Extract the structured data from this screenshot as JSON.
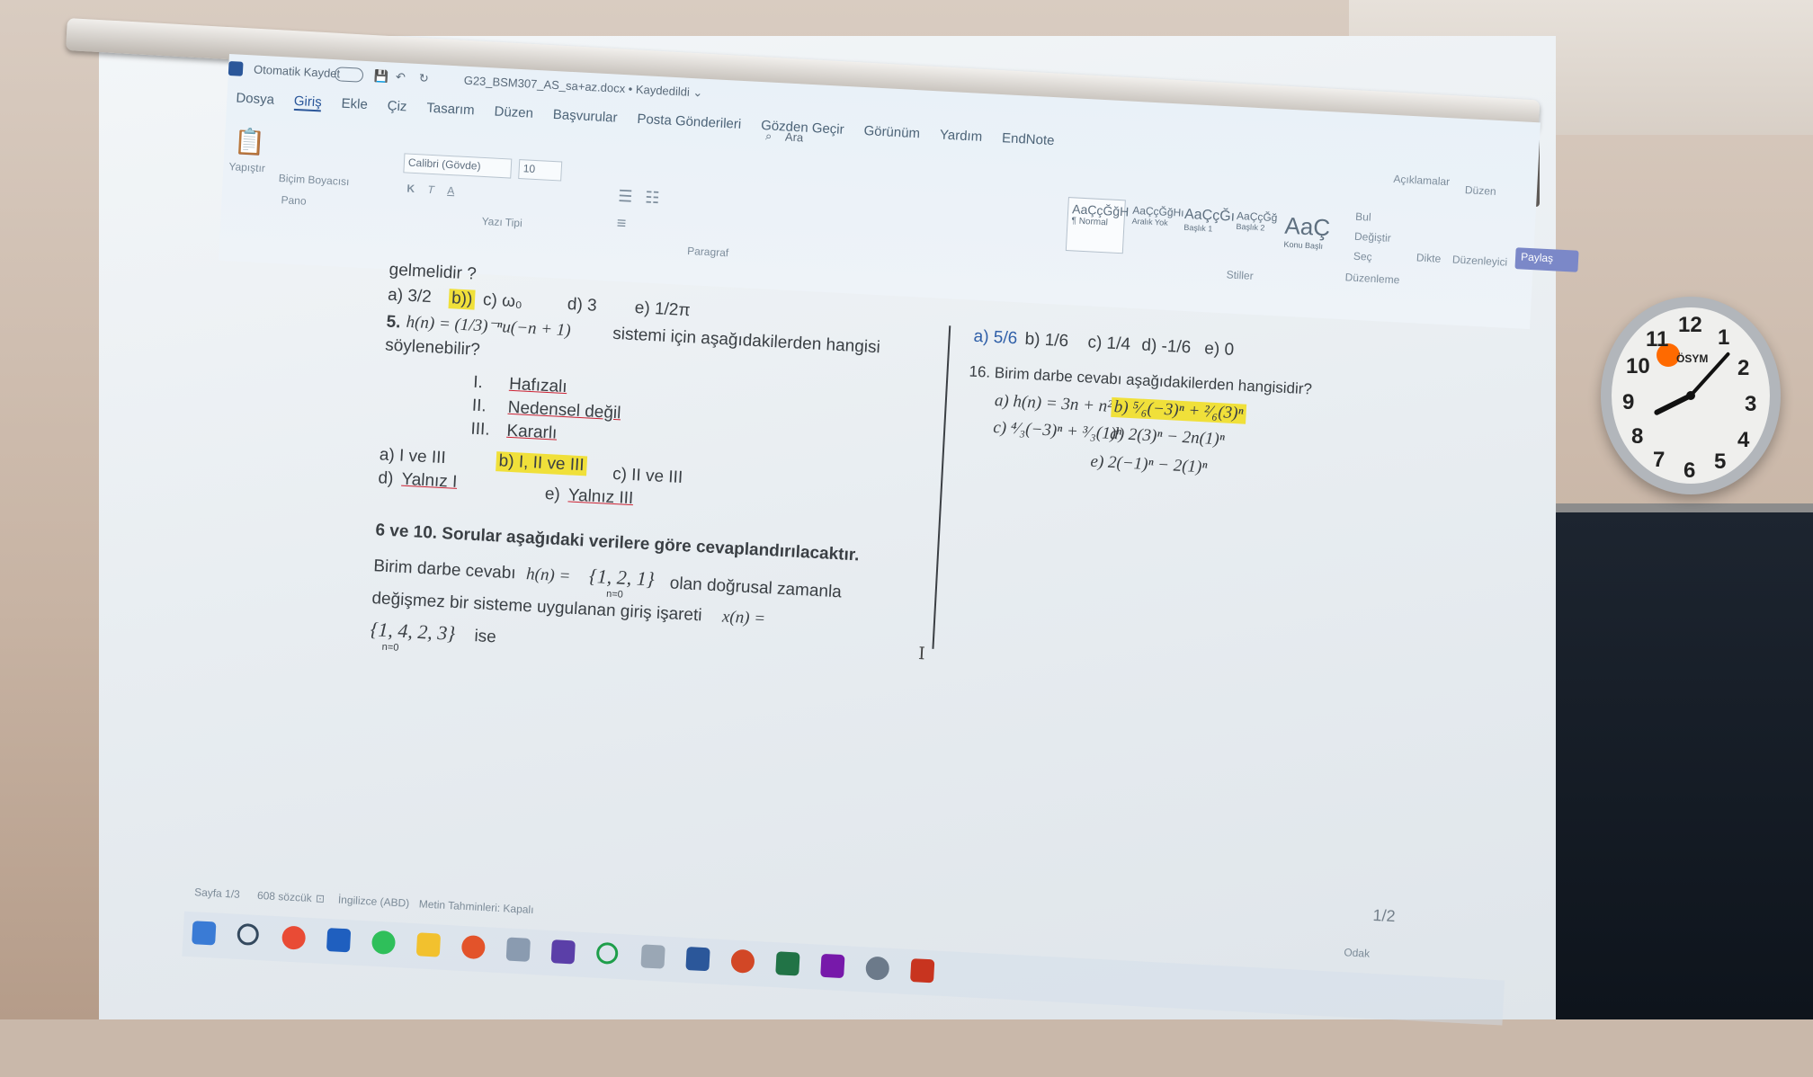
{
  "word": {
    "autosave_label": "Otomatik Kaydet",
    "file_title": "G23_BSM307_AS_sa+az.docx • Kaydedildi ⌄",
    "search_placeholder": "Ara",
    "menu": [
      "Dosya",
      "Giriş",
      "Ekle",
      "Çiz",
      "Tasarım",
      "Düzen",
      "Başvurular",
      "Posta Gönderileri",
      "Gözden Geçir",
      "Görünüm",
      "Yardım",
      "EndNote"
    ],
    "ribbon": {
      "paste": "Yapıştır",
      "format_painter": "Biçim Boyacısı",
      "clipboard_group": "Pano",
      "font_name": "Calibri (Gövde)",
      "font_size": "10",
      "font_group": "Yazı Tipi",
      "paragraph_group": "Paragraf",
      "style_normal": "AaÇçĞğH",
      "style_normal_label": "¶ Normal",
      "style_nospace": "AaÇçĞğHı",
      "style_nospace_label": "Aralık Yok",
      "style_h1": "AaÇçĞı",
      "style_h1_label": "Başlık 1",
      "style_h2": "AaÇçĞğ",
      "style_h2_label": "Başlık 2",
      "style_title": "AaÇ",
      "style_title_label": "Konu Başlı",
      "styles_group": "Stiller",
      "find": "Bul",
      "replace": "Değiştir",
      "select": "Seç",
      "editing_group": "Düzenleme",
      "dictate": "Dikte",
      "editor": "Düzenleyici",
      "comments": "Açıklamalar",
      "edit_mode": "Düzen",
      "share": "Paylaş"
    },
    "status": {
      "page": "Sayfa 1/3",
      "words": "608 sözcük",
      "language": "İngilizce (ABD)",
      "predictions": "Metin Tahminleri: Kapalı",
      "focus": "Odak",
      "page_indicator": "1/2"
    }
  },
  "document": {
    "left": {
      "q4_tail": "gelmelidir ?",
      "q4_opts": {
        "a": "a) 3/2",
        "b": "b))",
        "c": "c) ω₀",
        "d": "d) 3",
        "e": "e) 1/2π"
      },
      "q5_prefix": "5.",
      "q5_formula": "h(n) = (1/3)⁻ⁿu(−n + 1)",
      "q5_text": "sistemi için aşağıdakilerden hangisi",
      "q5_text2": "söylenebilir?",
      "items": [
        {
          "num": "I.",
          "text": "Hafızalı"
        },
        {
          "num": "II.",
          "text": "Nedensel değil"
        },
        {
          "num": "III.",
          "text": "Kararlı"
        }
      ],
      "q5_opts": {
        "a": "a) I ve III",
        "b": "b) I, II ve III",
        "c": "c) II ve III",
        "d_pre": "d) ",
        "d": "Yalnız I",
        "e_pre": "e) ",
        "e": "Yalnız III"
      },
      "section_title": "6 ve 10. Sorular aşağıdaki verilere göre cevaplandırılacaktır.",
      "section_l1a": "Birim darbe cevabı",
      "section_l1_formula": "h(n) =",
      "section_l1_set": "{1, 2, 1}",
      "section_l1_sub": "n=0",
      "section_l1b": "olan doğrusal zamanla",
      "section_l2": "değişmez bir sisteme uygulanan giriş işareti",
      "section_l2_formula": "x(n) =",
      "section_l3_set": "{1, 4, 2, 3}",
      "section_l3_sub": "n=0",
      "section_l3_tail": "ise"
    },
    "right": {
      "q15_opts": {
        "a": "a) 5/6",
        "b": "b) 1/6",
        "c": "c) 1/4",
        "d": "d) -1/6",
        "e": "e) 0"
      },
      "q16": "16. Birim darbe cevabı aşağıdakilerden hangisidir?",
      "q16_a": "a) h(n) = 3n + n²",
      "q16_b": "b) ⁵⁄₆(−3)ⁿ + ²⁄₆(3)ⁿ",
      "q16_c": "c) ⁴⁄₃(−3)ⁿ + ³⁄₃(1)ⁿ",
      "q16_d": "d) 2(3)ⁿ − 2n(1)ⁿ",
      "q16_e": "e) 2(−1)ⁿ − 2(1)ⁿ"
    }
  },
  "clock": {
    "brand": "ÖSYM",
    "numbers": [
      "12",
      "1",
      "2",
      "3",
      "4",
      "5",
      "6",
      "7",
      "8",
      "9",
      "10",
      "11"
    ],
    "time": "8:07"
  },
  "colors": {
    "highlight": "#f0e03a",
    "word_blue": "#2b579a",
    "screen": "#eef2f5"
  }
}
